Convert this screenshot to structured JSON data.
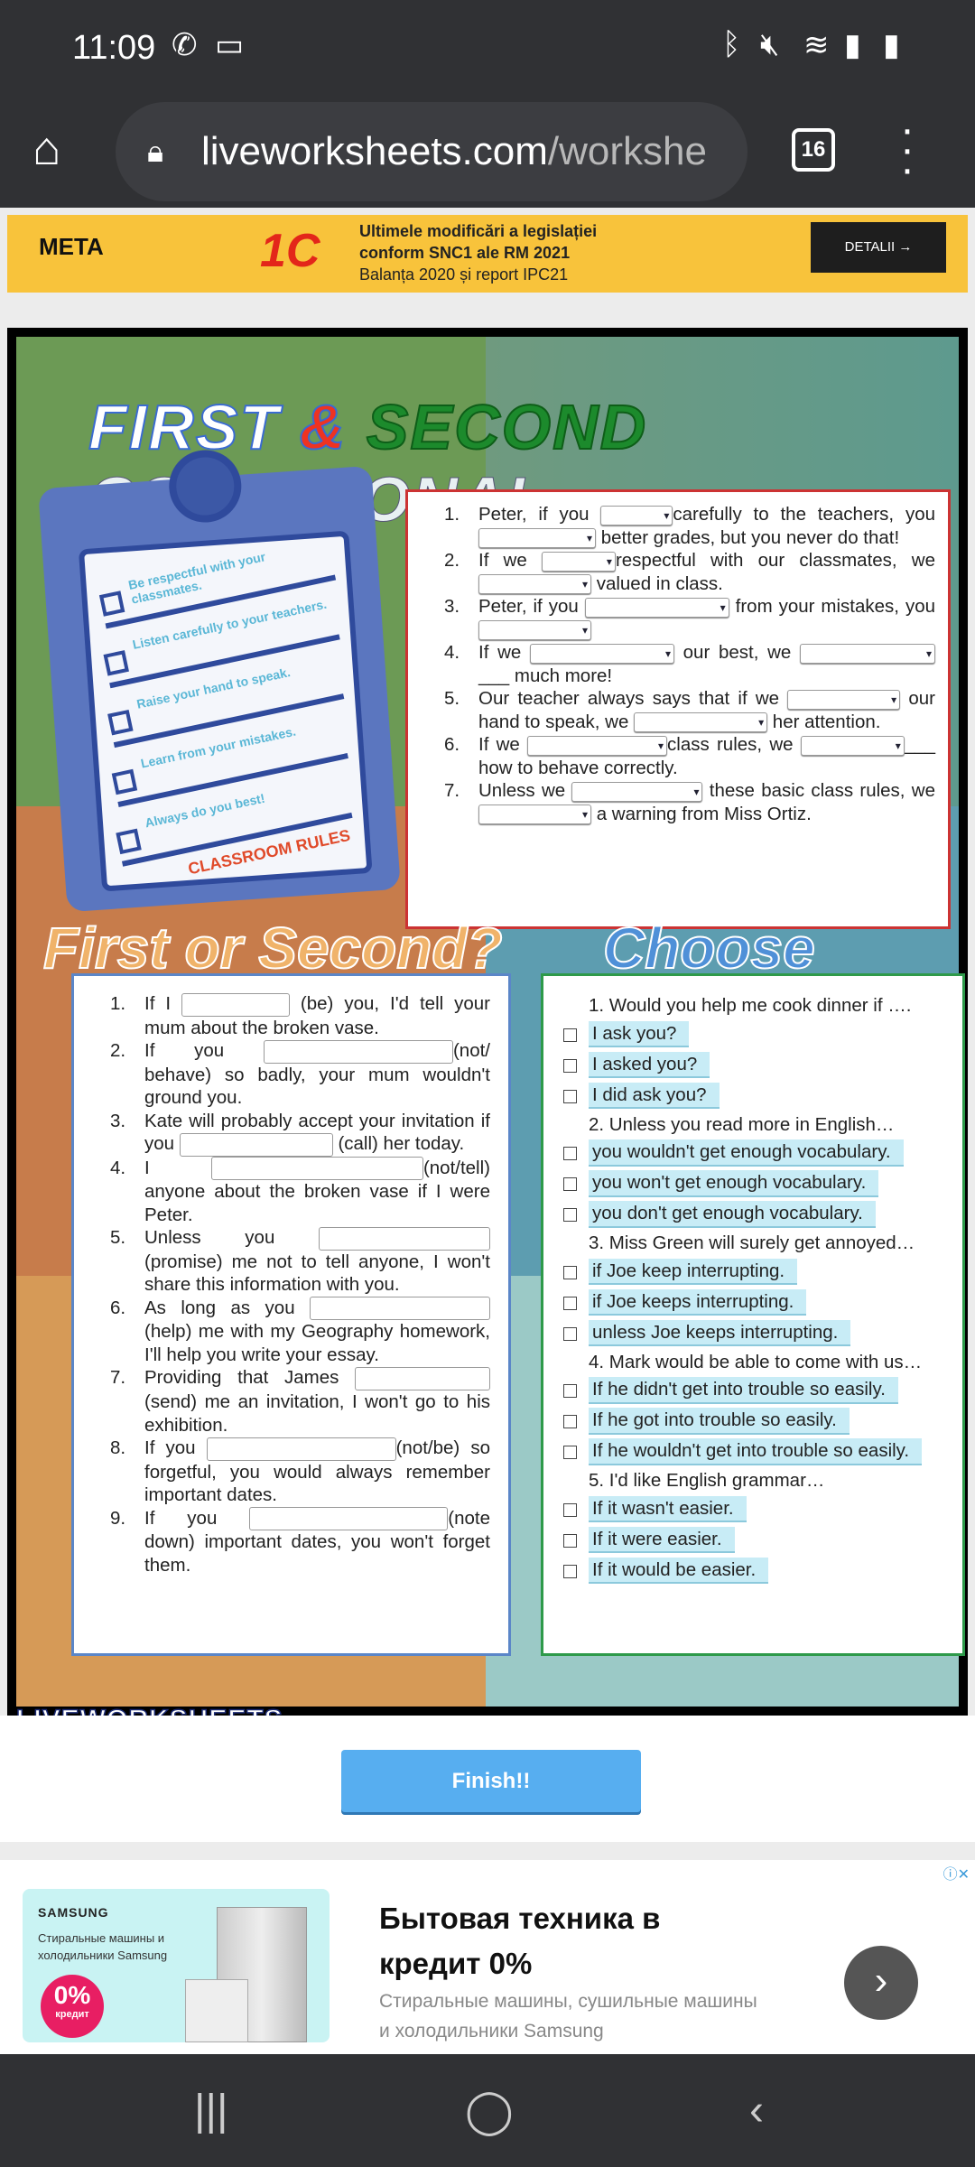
{
  "status": {
    "time": "11:09",
    "left_icons": [
      "whatsapp-icon",
      "video-icon"
    ],
    "right_icons": [
      "bluetooth-icon",
      "mute-icon",
      "wifi-icon",
      "signal-icon",
      "battery-icon"
    ]
  },
  "browser": {
    "url_main": "liveworksheets.com",
    "url_rest": "/workshe",
    "tab_count": "16"
  },
  "ad_top": {
    "brand": "META",
    "logo": "1C",
    "line1": "Ultimele modificări a legislației",
    "line2": "conform SNC1 ale RM 2021",
    "line3": "Balanța 2020 și report IPC21",
    "button": "DETALII →"
  },
  "worksheet": {
    "title": {
      "w1": "FIRST",
      "amp": "&",
      "w2": "SECOND",
      "w3": "CONDITIONAL"
    },
    "clipboard": {
      "rules": [
        "Be respectful with your classmates.",
        "Listen carefully to your teachers.",
        "Raise your hand to speak.",
        "Learn from your mistakes.",
        "Always do you best!"
      ],
      "caption": "CLASSROOM RULES"
    },
    "ex1": [
      [
        [
          "t",
          "Peter, if you "
        ],
        [
          "s",
          80
        ],
        [
          "t",
          "carefully to the teachers, you "
        ],
        [
          "s",
          130
        ],
        [
          "t",
          " better grades, but you never do that!"
        ]
      ],
      [
        [
          "t",
          "If we "
        ],
        [
          "s",
          82
        ],
        [
          "t",
          "respectful with our classmates, we "
        ],
        [
          "s",
          125
        ],
        [
          "t",
          " valued in class."
        ]
      ],
      [
        [
          "t",
          "Peter, if you "
        ],
        [
          "s",
          160
        ],
        [
          "t",
          " from your mistakes, you "
        ],
        [
          "s",
          125
        ]
      ],
      [
        [
          "t",
          "If we "
        ],
        [
          "s",
          160
        ],
        [
          "t",
          " our best, we "
        ],
        [
          "s",
          150
        ],
        [
          "t",
          "___ much more!"
        ]
      ],
      [
        [
          "t",
          "Our teacher always says that if we "
        ],
        [
          "s",
          125
        ],
        [
          "t",
          " our hand to speak, we "
        ],
        [
          "s",
          148
        ],
        [
          "t",
          " her attention."
        ]
      ],
      [
        [
          "t",
          "If we "
        ],
        [
          "s",
          155
        ],
        [
          "t",
          "class rules, we "
        ],
        [
          "s",
          115
        ],
        [
          "t",
          "___ how to behave correctly."
        ]
      ],
      [
        [
          "t",
          "Unless we "
        ],
        [
          "s",
          145
        ],
        [
          "t",
          " these basic class rules, we "
        ],
        [
          "s",
          125
        ],
        [
          "t",
          " a warning from Miss Ortiz."
        ]
      ]
    ],
    "subtitle1": "First or Second?",
    "subtitle2": "Choose",
    "ex2": [
      [
        [
          "t",
          "If I "
        ],
        [
          "i",
          120
        ],
        [
          "t",
          " (be) you, I'd tell your mum about the broken vase."
        ]
      ],
      [
        [
          "t",
          "If you "
        ],
        [
          "i",
          210
        ],
        [
          "t",
          "(not/ behave) so badly, your mum wouldn't ground you."
        ]
      ],
      [
        [
          "t",
          "Kate will probably accept your invitation if you "
        ],
        [
          "i",
          170
        ],
        [
          "t",
          " (call) her today."
        ]
      ],
      [
        [
          "t",
          "I "
        ],
        [
          "i",
          235
        ],
        [
          "t",
          "(not/tell) anyone about the broken vase if I were Peter."
        ]
      ],
      [
        [
          "t",
          "Unless you "
        ],
        [
          "i",
          190
        ],
        [
          "t",
          " (promise) me not to tell anyone, I won't share this information with you."
        ]
      ],
      [
        [
          "t",
          "As long as you "
        ],
        [
          "i",
          200
        ],
        [
          "t",
          " (help) me with my Geography homework, I'll help you write your essay."
        ]
      ],
      [
        [
          "t",
          "Providing that James "
        ],
        [
          "i",
          150
        ],
        [
          "t",
          " (send) me an invitation, I won't go to his exhibition."
        ]
      ],
      [
        [
          "t",
          "If you "
        ],
        [
          "i",
          210
        ],
        [
          "t",
          "(not/be) so forgetful, you would always remember important dates."
        ]
      ],
      [
        [
          "t",
          "If you "
        ],
        [
          "i",
          220
        ],
        [
          "t",
          "(note down) important dates, you won't forget them."
        ]
      ]
    ],
    "ex3": [
      {
        "q": "1. Would you help me cook dinner if ….",
        "options": [
          "I ask you?",
          "I asked you?",
          "I did ask you?"
        ]
      },
      {
        "q": "2. Unless you read more in English…",
        "options": [
          "you wouldn't get enough vocabulary.",
          "you won't get enough vocabulary.",
          "you don't get enough vocabulary."
        ]
      },
      {
        "q": "3. Miss Green will surely get annoyed…",
        "options": [
          "if Joe keep interrupting.",
          "if Joe keeps interrupting.",
          "unless Joe keeps interrupting."
        ]
      },
      {
        "q": "4. Mark would be able to come with us…",
        "options": [
          "If he didn't get into trouble so easily.",
          "If he got into trouble so easily.",
          "If he wouldn't get into trouble so easily."
        ]
      },
      {
        "q": "5. I'd like English grammar…",
        "options": [
          "If it wasn't easier.",
          "If it were easier.",
          "If it would be easier."
        ]
      }
    ],
    "logo": "LIVEWORKSHEETS",
    "finish": "Finish!!"
  },
  "ad_bottom": {
    "brand": "SAMSUNG",
    "image_text": "Стиральные машины и холодильники Samsung",
    "badge": "0%",
    "badge_sub": "кредит",
    "headline": "Бытовая техника в кредит 0%",
    "text": "Стиральные машины, сушильные машины и холодильники Samsung"
  },
  "navbar": {
    "recent": "|||",
    "home": "◯",
    "back": "‹"
  }
}
